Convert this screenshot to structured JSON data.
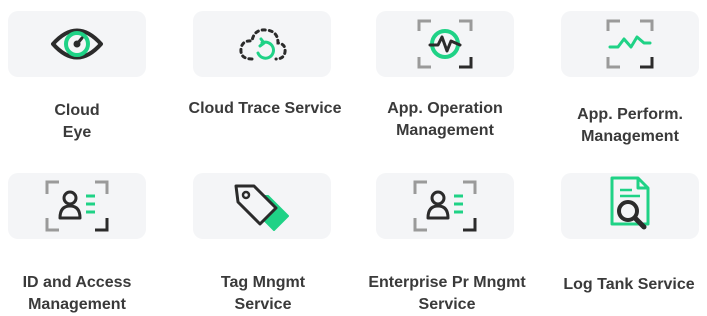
{
  "colors": {
    "accent": "#1fd286",
    "dark": "#2b2b2b",
    "frame": "#9a9a9a",
    "tile_bg": "#f4f5f7",
    "text": "#3a3a3a"
  },
  "services": [
    {
      "id": "cloud-eye",
      "icon": "eye-icon",
      "lines": [
        "Cloud",
        "Eye"
      ]
    },
    {
      "id": "cloud-trace-service",
      "icon": "cloud-refresh-icon",
      "lines": [
        "Cloud Trace Service"
      ]
    },
    {
      "id": "app-operation-management",
      "icon": "heartbeat-monitor-icon",
      "lines": [
        "App. Operation",
        "Management"
      ]
    },
    {
      "id": "app-perform-management",
      "icon": "performance-line-icon",
      "lines": [
        "App. Perform.",
        "Management"
      ]
    },
    {
      "id": "id-and-access-management",
      "icon": "id-card-icon",
      "lines": [
        "ID and Access",
        "Management"
      ]
    },
    {
      "id": "tag-mngmt-service",
      "icon": "tags-icon",
      "lines": [
        "Tag Mngmt",
        "Service"
      ]
    },
    {
      "id": "enterprise-pr-mngmt-service",
      "icon": "id-card-icon",
      "lines": [
        "Enterprise Pr Mngmt",
        "Service"
      ]
    },
    {
      "id": "log-tank-service",
      "icon": "log-search-icon",
      "lines": [
        "Log Tank Service"
      ]
    }
  ]
}
